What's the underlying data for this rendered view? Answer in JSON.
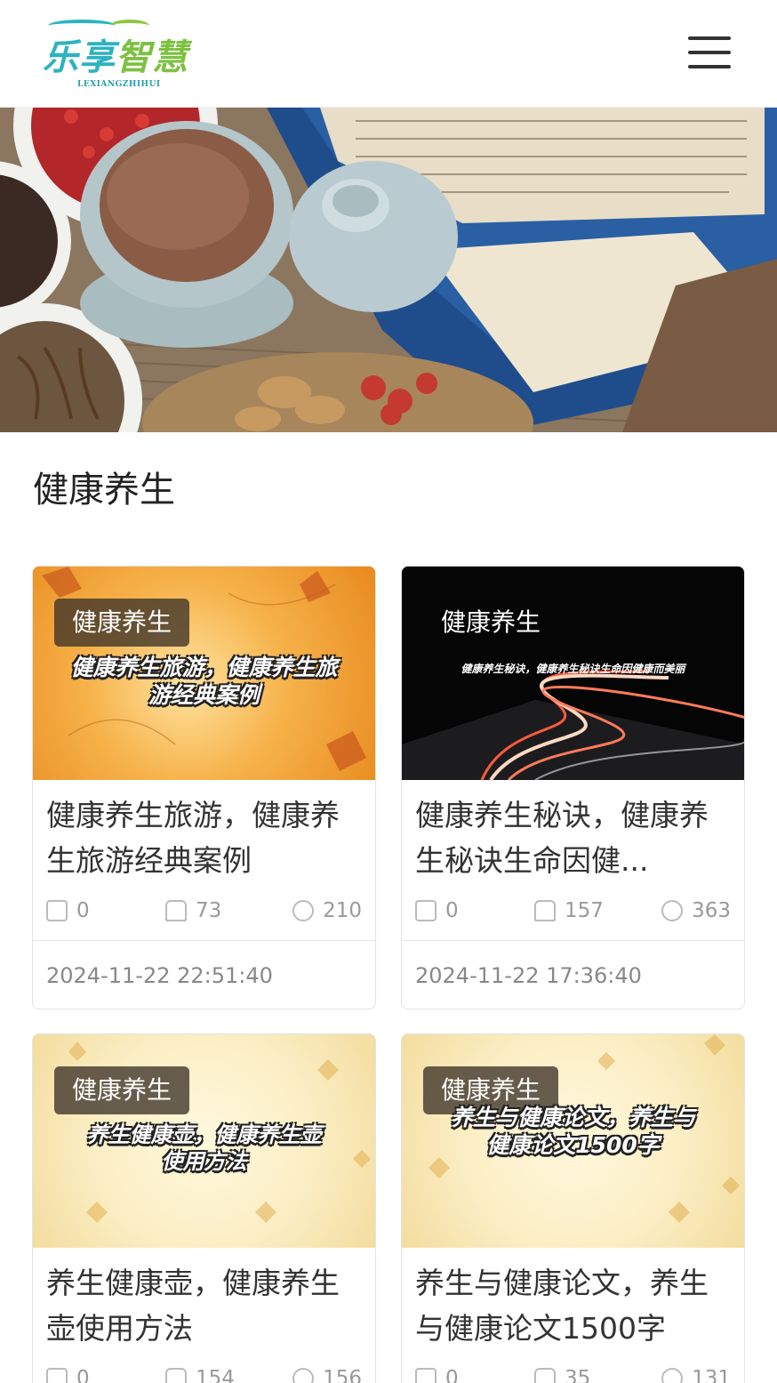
{
  "header": {
    "logo_cn": "乐享智慧",
    "logo_en": "LEXIANGZHIHUI",
    "menu_icon": "hamburger-menu-icon"
  },
  "section": {
    "title": "健康养生"
  },
  "cards": [
    {
      "tag": "健康养生",
      "thumb_text": "健康养生旅游，健康养生旅游经典案例",
      "title": "健康养生旅游，健康养生旅游经典案例",
      "stats": [
        "0",
        "73",
        "210"
      ],
      "date": "2024-11-22 22:51:40"
    },
    {
      "tag": "健康养生",
      "thumb_text": "健康养生秘诀，健康养生秘诀生命因健康而美丽",
      "title": "健康养生秘诀，健康养生秘诀生命因健...",
      "stats": [
        "0",
        "157",
        "363"
      ],
      "date": "2024-11-22 17:36:40"
    },
    {
      "tag": "健康养生",
      "thumb_text": "养生健康壶，健康养生壶使用方法",
      "title": "养生健康壶，健康养生壶使用方法",
      "stats": [
        "0",
        "154",
        "156"
      ],
      "date": ""
    },
    {
      "tag": "健康养生",
      "thumb_text": "养生与健康论文，养生与健康论文1500字",
      "title": "养生与健康论文，养生与健康论文1500字",
      "stats": [
        "0",
        "35",
        "131"
      ],
      "date": ""
    }
  ]
}
